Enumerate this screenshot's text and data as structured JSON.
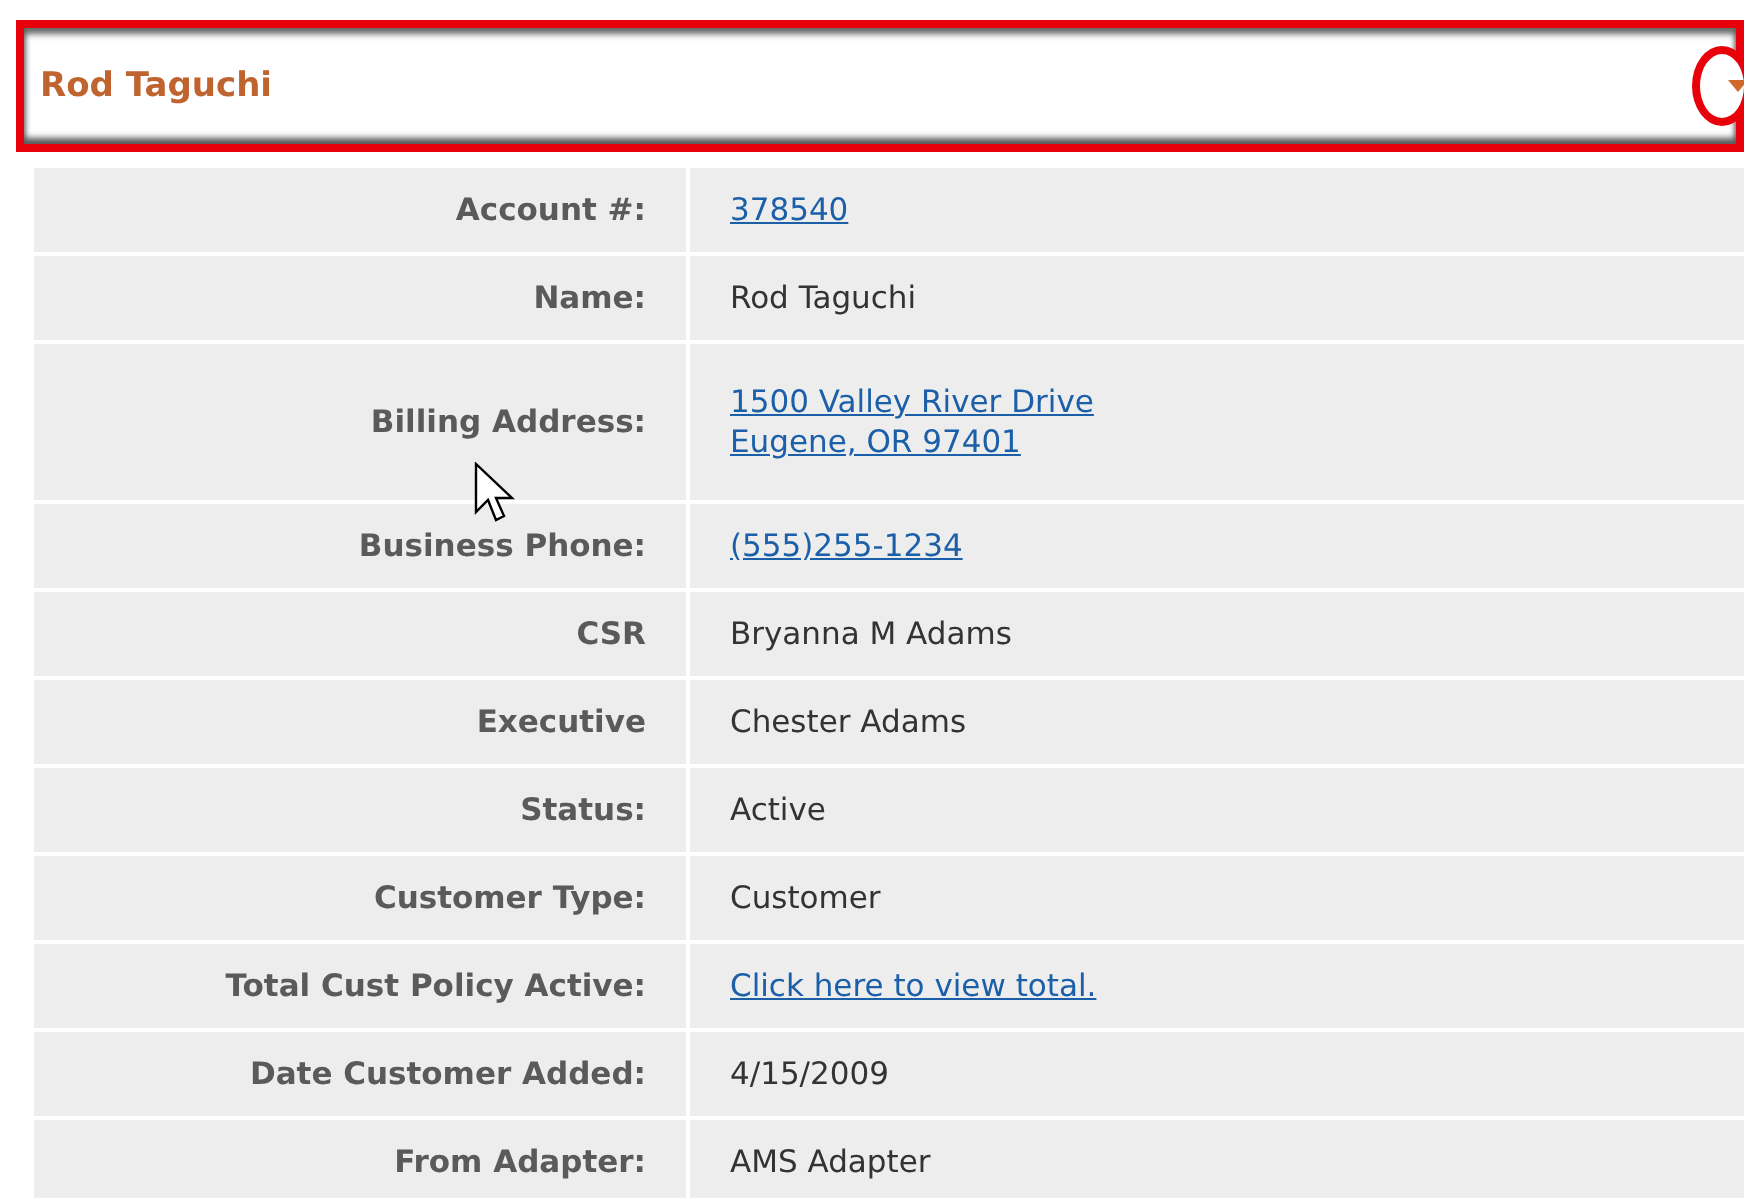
{
  "header": {
    "title": "Rod Taguchi",
    "highlighted": true
  },
  "rows": [
    {
      "label": "Account #:",
      "kind": "link",
      "values": [
        "378540"
      ]
    },
    {
      "label": "Name:",
      "kind": "text",
      "values": [
        "Rod Taguchi"
      ]
    },
    {
      "label": "Billing Address:",
      "kind": "link",
      "values": [
        "1500 Valley River Drive",
        "Eugene, OR 97401"
      ]
    },
    {
      "label": "Business Phone:",
      "kind": "link",
      "values": [
        "(555)255-1234"
      ]
    },
    {
      "label": "CSR",
      "kind": "text",
      "values": [
        "Bryanna M Adams"
      ]
    },
    {
      "label": "Executive",
      "kind": "text",
      "values": [
        "Chester Adams"
      ]
    },
    {
      "label": "Status:",
      "kind": "text",
      "values": [
        "Active"
      ]
    },
    {
      "label": "Customer Type:",
      "kind": "text",
      "values": [
        "Customer"
      ]
    },
    {
      "label": "Total Cust Policy Active:",
      "kind": "link",
      "values": [
        "Click here to view total."
      ]
    },
    {
      "label": "Date Customer Added:",
      "kind": "text",
      "values": [
        "4/15/2009"
      ]
    },
    {
      "label": "From Adapter:",
      "kind": "text",
      "values": [
        "AMS Adapter"
      ]
    }
  ]
}
